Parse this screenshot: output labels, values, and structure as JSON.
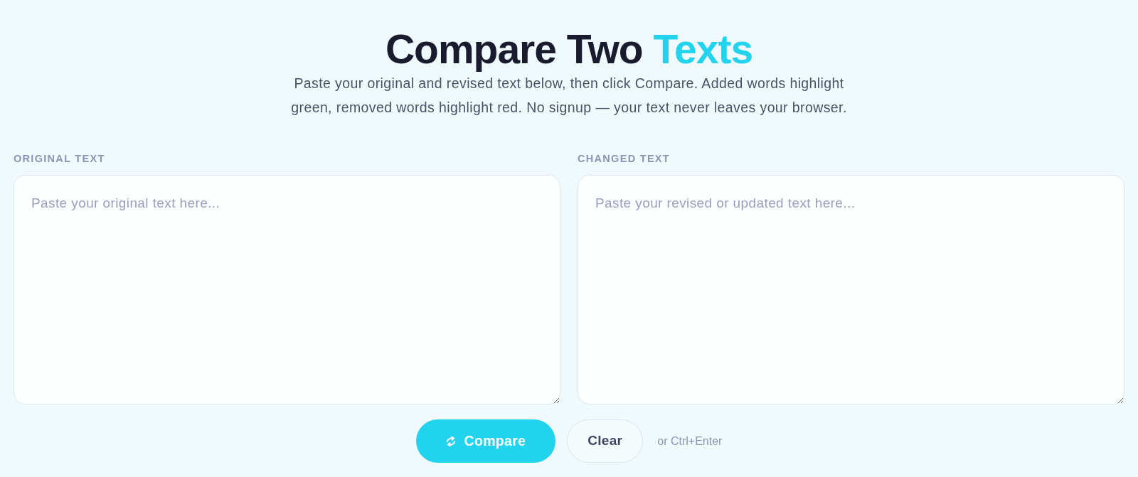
{
  "header": {
    "title": "Compare Two",
    "title_highlight": "Texts",
    "subtitle": "Paste your original and revised text below, then click Compare. Added words highlight green, removed words highlight red. No signup — your text never leaves your browser."
  },
  "panels": [
    {
      "label": "ORIGINAL TEXT",
      "placeholder": "Paste your original text here..."
    },
    {
      "label": "CHANGED TEXT",
      "placeholder": "Paste your revised or updated text here..."
    }
  ],
  "actions": {
    "buttons": [
      {
        "label": "Compare",
        "kind": "primary"
      },
      {
        "label": "Clear",
        "kind": "secondary"
      }
    ],
    "hint": "or Ctrl+Enter"
  }
}
